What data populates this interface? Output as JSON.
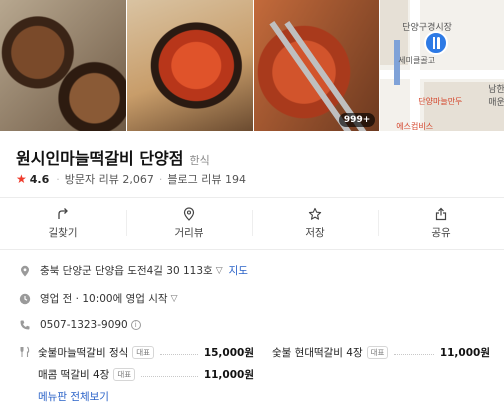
{
  "photos": {
    "more_badge": "999+"
  },
  "map": {
    "label_market": "단양구경시장",
    "label_cafe": "세미클골고",
    "label_restaurant": "단양마늘만두",
    "label_right": "남한",
    "label_right2": "매운",
    "label_bottom": "에스컴비스"
  },
  "place": {
    "name": "원시인마늘떡갈비 단양점",
    "category": "한식",
    "rating": "4.6",
    "visitor_reviews": "방문자 리뷰 2,067",
    "blog_reviews": "블로그 리뷰 194"
  },
  "actions": [
    {
      "label": "길찾기",
      "icon": "directions-icon"
    },
    {
      "label": "거리뷰",
      "icon": "street-view-icon"
    },
    {
      "label": "저장",
      "icon": "star-outline-icon"
    },
    {
      "label": "공유",
      "icon": "share-icon"
    }
  ],
  "info": {
    "address": "충북 단양군 단양읍 도전4길 30 113호",
    "map_link": "지도",
    "hours": "영업 전 · 10:00에 영업 시작",
    "phone": "0507-1323-9090"
  },
  "menu": [
    {
      "name": "숯불마늘떡갈비 정식",
      "tag": "대표",
      "price": "15,000원"
    },
    {
      "name": "숯불 현대떡갈비 4장",
      "tag": "대표",
      "price": "11,000원"
    },
    {
      "name": "매콤 떡갈비 4장",
      "tag": "대표",
      "price": "11,000원"
    }
  ],
  "menu_more": "메뉴판 전체보기",
  "colors": {
    "accent_blue": "#2a62c8",
    "star_red": "#ef3b2c",
    "pin_blue": "#2d7ae5"
  }
}
